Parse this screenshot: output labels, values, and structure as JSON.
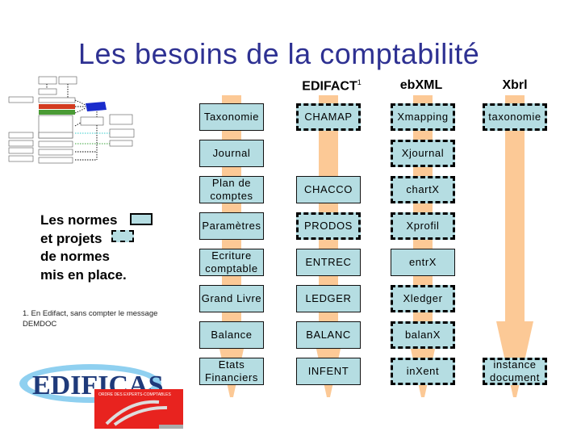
{
  "title": "Les besoins de la comptabilité",
  "legend": {
    "lines": [
      "Les normes",
      "et projets",
      "de normes",
      "mis en place."
    ],
    "solid_meaning": "Les normes",
    "dashed_meaning": "et projets de normes"
  },
  "footnote": "1. En Edifact, sans compter le message DEMDOC",
  "logo": {
    "name": "EDIFICAS",
    "sub": "ORDRE DES EXPERTS-COMPTABLES"
  },
  "colors": {
    "title": "#2e3192",
    "cell_fill": "#b5dde2",
    "arrow": "#fcc996"
  },
  "columns": [
    {
      "header": "",
      "cells": [
        {
          "label": "Taxonomie",
          "style": "solid"
        },
        {
          "label": "Journal",
          "style": "solid"
        },
        {
          "label": "Plan de comptes",
          "style": "solid"
        },
        {
          "label": "Paramètres",
          "style": "solid"
        },
        {
          "label": "Ecriture comptable",
          "style": "solid"
        },
        {
          "label": "Grand Livre",
          "style": "solid"
        },
        {
          "label": "Balance",
          "style": "solid"
        },
        {
          "label": "Etats Financiers",
          "style": "solid"
        }
      ]
    },
    {
      "header": "EDIFACT",
      "header_sup": "1",
      "cells": [
        {
          "label": "CHAMAP",
          "style": "dashed"
        },
        {
          "label": "",
          "style": "none"
        },
        {
          "label": "CHACCO",
          "style": "solid"
        },
        {
          "label": "PRODOS",
          "style": "dashed"
        },
        {
          "label": "ENTREC",
          "style": "solid"
        },
        {
          "label": "LEDGER",
          "style": "solid"
        },
        {
          "label": "BALANC",
          "style": "solid"
        },
        {
          "label": "INFENT",
          "style": "solid"
        }
      ]
    },
    {
      "header": "ebXML",
      "cells": [
        {
          "label": "Xmapping",
          "style": "dashed"
        },
        {
          "label": "Xjournal",
          "style": "dashed"
        },
        {
          "label": "chartX",
          "style": "dashed"
        },
        {
          "label": "Xprofil",
          "style": "dashed"
        },
        {
          "label": "entrX",
          "style": "solid"
        },
        {
          "label": "Xledger",
          "style": "dashed"
        },
        {
          "label": "balanX",
          "style": "dashed"
        },
        {
          "label": "inXent",
          "style": "dashed"
        }
      ]
    },
    {
      "header": "Xbrl",
      "cells": [
        {
          "label": "taxonomie",
          "style": "dashed"
        },
        {
          "label": "",
          "style": "none"
        },
        {
          "label": "",
          "style": "none"
        },
        {
          "label": "",
          "style": "none"
        },
        {
          "label": "",
          "style": "none"
        },
        {
          "label": "",
          "style": "none"
        },
        {
          "label": "",
          "style": "none"
        },
        {
          "label": "instance document",
          "style": "dashed"
        }
      ]
    }
  ]
}
